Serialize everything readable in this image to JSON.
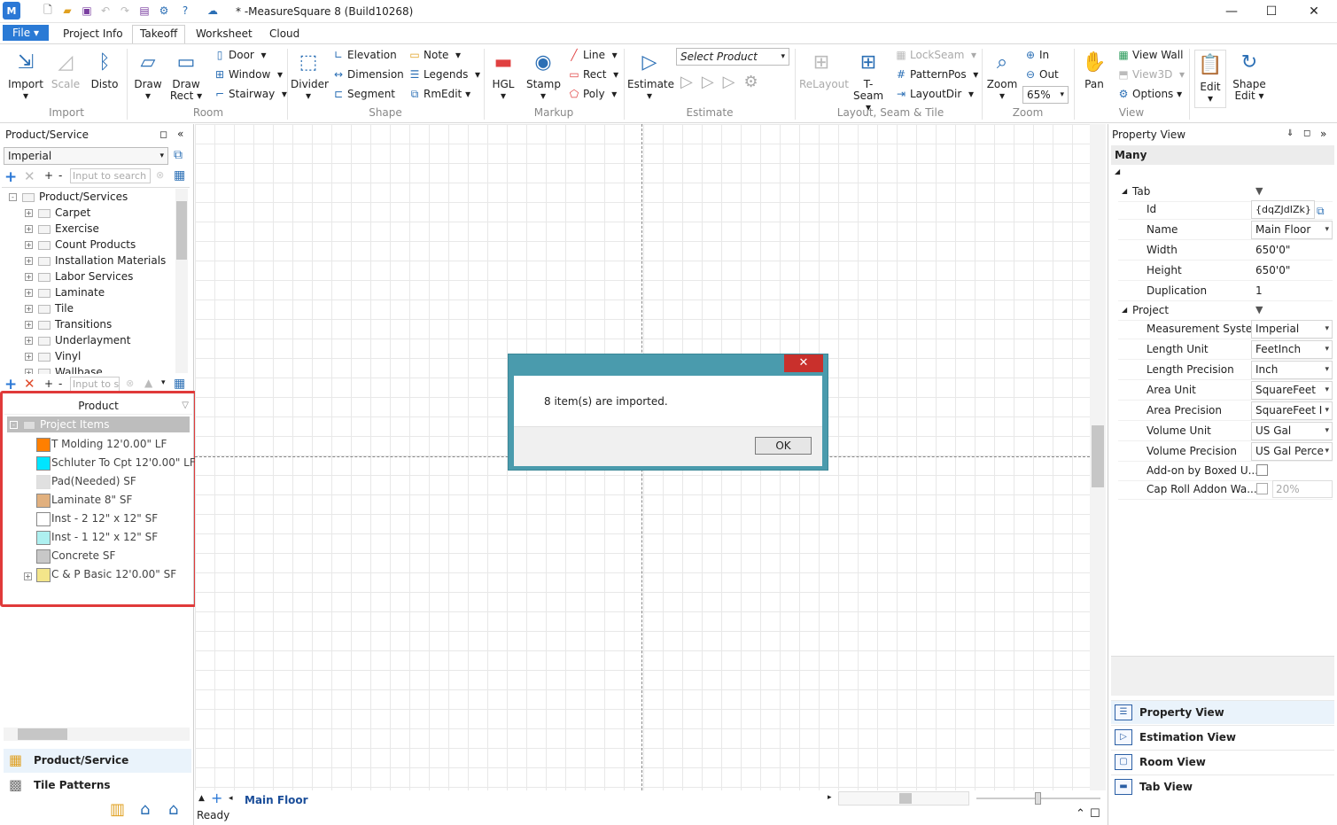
{
  "window": {
    "title": "* -MeasureSquare 8 (Build10268)",
    "app_icon": "M"
  },
  "menu": {
    "file": "File",
    "tabs": [
      "Project Info",
      "Takeoff",
      "Worksheet",
      "Cloud"
    ]
  },
  "ribbon": {
    "import": "Import",
    "scale": "Scale",
    "disto": "Disto",
    "draw": "Draw",
    "draw_rect": "Draw Rect",
    "door": "Door",
    "window": "Window",
    "stairway": "Stairway",
    "divider": "Divider",
    "elevation": "Elevation",
    "dimension": "Dimension",
    "segment": "Segment",
    "note": "Note",
    "legends": "Legends",
    "rmedit": "RmEdit",
    "hgl": "HGL",
    "stamp": "Stamp",
    "line": "Line",
    "rect": "Rect",
    "poly": "Poly",
    "estimate": "Estimate",
    "select_product": "Select Product",
    "relayout": "ReLayout",
    "tseam": "T-Seam",
    "lockseam": "LockSeam",
    "patternpos": "PatternPos",
    "layoutdir": "LayoutDir",
    "zoom": "Zoom",
    "zoom_in": "In",
    "zoom_out": "Out",
    "zoom_level": "65%",
    "pan": "Pan",
    "view_wall": "View Wall",
    "view3d": "View3D",
    "options": "Options",
    "edit": "Edit",
    "shape_edit": "Shape Edit",
    "groups": {
      "import": "Import",
      "room": "Room",
      "shape": "Shape",
      "markup": "Markup",
      "estimate": "Estimate",
      "layout": "Layout, Seam & Tile",
      "zoom": "Zoom",
      "view": "View"
    }
  },
  "left_panel": {
    "title": "Product/Service",
    "unit_system": "Imperial",
    "search_placeholder": "Input to search",
    "search_placeholder2": "Input to se",
    "tree_root": "Product/Services",
    "categories": [
      "Carpet",
      "Exercise",
      "Count Products",
      "Installation Materials",
      "Labor Services",
      "Laminate",
      "Tile",
      "Transitions",
      "Underlayment",
      "Vinyl",
      "Wallbase"
    ],
    "product_header": "Product",
    "project_items_label": "Project Items",
    "project_items": [
      {
        "label": "T Molding 12'0.00\" LF",
        "color": "#ff7f00"
      },
      {
        "label": "Schluter To Cpt 12'0.00\" LF",
        "color": "#00e5ff"
      },
      {
        "label": "Pad(Needed)  SF",
        "color": "#e0e0e0"
      },
      {
        "label": "Laminate 8\" SF",
        "color": "#e1b07e"
      },
      {
        "label": "Inst -  2 12\" x 12\" SF",
        "color": "#ffffff"
      },
      {
        "label": "Inst -  1 12\" x 12\" SF",
        "color": "#aef0f0"
      },
      {
        "label": "Concrete  SF",
        "color": "#c8c8c8"
      },
      {
        "label": "C & P Basic 12'0.00\" SF",
        "color": "#f3e58a"
      }
    ],
    "bottom_tabs": [
      "Product/Service",
      "Tile Patterns"
    ]
  },
  "canvas": {
    "floor_tab": "Main Floor",
    "status": "Ready"
  },
  "dialog": {
    "message": "8 item(s) are imported.",
    "ok": "OK"
  },
  "right_panel": {
    "title": "Property View",
    "selection": "Many",
    "section_tab": "Tab",
    "section_project": "Project",
    "tab_props": [
      {
        "label": "Id",
        "value": "{dqZJdIZk}"
      },
      {
        "label": "Name",
        "value": "Main Floor"
      },
      {
        "label": "Width",
        "value": "650'0\""
      },
      {
        "label": "Height",
        "value": "650'0\""
      },
      {
        "label": "Duplication",
        "value": "1"
      }
    ],
    "project_props": [
      {
        "label": "Measurement System",
        "value": "Imperial"
      },
      {
        "label": "Length Unit",
        "value": "FeetInch"
      },
      {
        "label": "Length Precision",
        "value": "Inch"
      },
      {
        "label": "Area Unit",
        "value": "SquareFeet"
      },
      {
        "label": "Area Precision",
        "value": "SquareFeet I"
      },
      {
        "label": "Volume Unit",
        "value": "US Gal"
      },
      {
        "label": "Volume Precision",
        "value": "US Gal Perce"
      },
      {
        "label": "Add-on by Boxed U...",
        "value": ""
      },
      {
        "label": "Cap Roll Addon Wa...",
        "value": "20%"
      }
    ],
    "nav": [
      "Property View",
      "Estimation View",
      "Room View",
      "Tab View"
    ]
  }
}
